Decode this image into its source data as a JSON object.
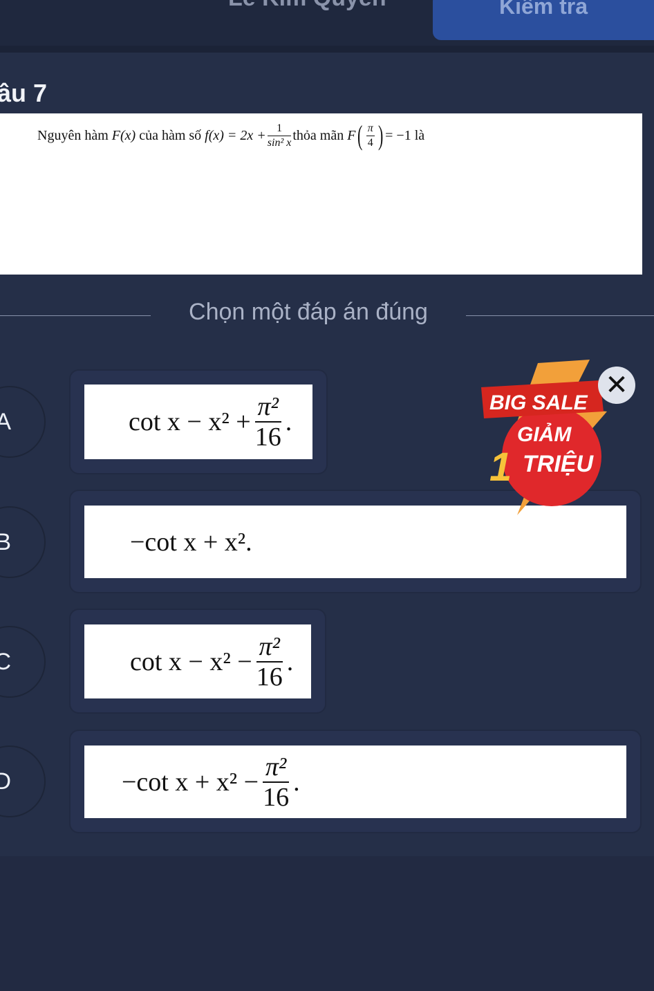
{
  "header": {
    "name": "Lê Kim Quyên",
    "check_button": "Kiểm tra"
  },
  "question": {
    "title": "âu 7",
    "text_before": "Nguyên hàm",
    "F_of_x": "F(x)",
    "text_mid": "của hàm số",
    "f_of_x": "f(x) = 2x +",
    "frac_num": "1",
    "frac_den": "sin² x",
    "text_cond": "thỏa mãn",
    "cond_F": "F",
    "cond_num": "π",
    "cond_den": "4",
    "cond_rhs": "= −1",
    "text_end": "là"
  },
  "prompt": "Chọn một đáp án đúng",
  "options": [
    {
      "letter": "A",
      "expr": "cot x − x² +",
      "frac_num": "π²",
      "frac_den": "16",
      "tail": "."
    },
    {
      "letter": "B",
      "expr": "−cot x + x².",
      "frac_num": "",
      "frac_den": "",
      "tail": ""
    },
    {
      "letter": "C",
      "expr": "cot x − x² −",
      "frac_num": "π²",
      "frac_den": "16",
      "tail": "."
    },
    {
      "letter": "D",
      "expr": "−cot x + x² −",
      "frac_num": "π²",
      "frac_den": "16",
      "tail": "."
    }
  ],
  "promo": {
    "line1": "BIG SALE",
    "line2": "GIẢM",
    "line3_num": "1",
    "line3": "TRIỆU",
    "close_icon": "close-icon"
  },
  "colors": {
    "background": "#252f48",
    "card": "#283250",
    "accent_button": "#2b4f9e",
    "promo_red": "#e0282b"
  }
}
